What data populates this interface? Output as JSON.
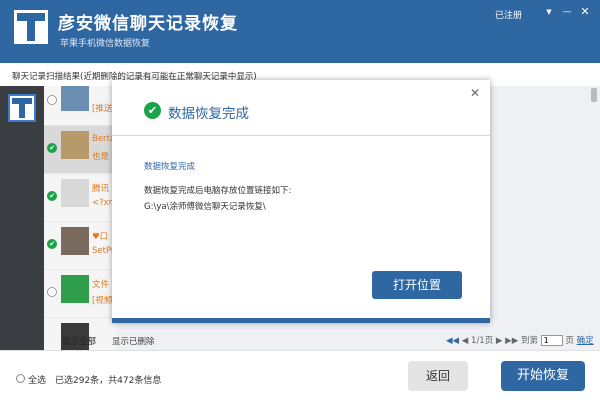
{
  "app": {
    "title": "彦安微信聊天记录恢复",
    "subtitle": "苹果手机微信数据恢复",
    "registered": "已注册"
  },
  "window_controls": [
    {
      "icon": "dropdown-icon",
      "glyph": "▼"
    },
    {
      "icon": "minimize-icon",
      "glyph": "—"
    },
    {
      "icon": "close-icon",
      "glyph": "✕"
    }
  ],
  "scan_result_label": "聊天记录扫描结果(近期删除的记录有可能在正常聊天记录中显示)",
  "list": {
    "rows": [
      {
        "checked": false,
        "name": "[推送",
        "message": "[推送",
        "avatar_color": "#6a8fb3"
      },
      {
        "checked": true,
        "name": "Berta",
        "message": "也是",
        "avatar_color": "#b89a6a"
      },
      {
        "checked": true,
        "name": "腾讯",
        "message": "<?xm",
        "avatar_color": "#d8d8d8"
      },
      {
        "checked": true,
        "name": "♥口",
        "message": "SetPu",
        "avatar_color": "#7a6b5e"
      },
      {
        "checked": false,
        "name": "文件",
        "message": "[视频",
        "avatar_color": "#2e9e4a"
      },
      {
        "checked": false,
        "name": "",
        "message": "",
        "avatar_color": "#3a3a3a"
      }
    ]
  },
  "filters": {
    "show_all": "显示全部",
    "show_deleted": "显示已删除"
  },
  "pager": {
    "prev_icon": "◀◀",
    "prev_single": "◀",
    "page_info": "1/1页",
    "next_single": "▶",
    "next_icon": "▶▶",
    "goto_label": "到第",
    "page_value": "1",
    "page_unit": "页",
    "confirm": "确定"
  },
  "bottom": {
    "select_all": "全选",
    "count_text": "已选292条，共472条信息",
    "back_button": "返回",
    "start_button": "开始恢复"
  },
  "dialog": {
    "title": "数据恢复完成",
    "subtitle": "数据恢复完成",
    "description": "数据恢复完成后电脑存放位置链接如下:",
    "path": "G:\\ya\\涂师傅微信聊天记录恢复\\",
    "open_button": "打开位置",
    "close_glyph": "✕",
    "check_glyph": "✔"
  },
  "colors": {
    "brand_blue": "#2f67a3",
    "success_green": "#1aa34a",
    "name_orange": "#e07a1f"
  }
}
